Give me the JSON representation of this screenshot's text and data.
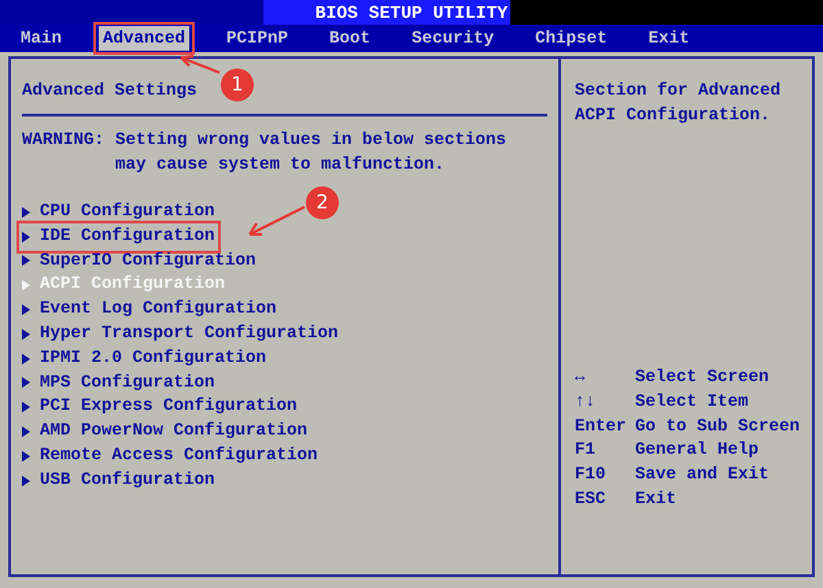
{
  "window": {
    "title": "BIOS SETUP UTILITY"
  },
  "tabs": [
    {
      "label": "Main",
      "selected": false
    },
    {
      "label": "Advanced",
      "selected": true,
      "callout": {
        "number": "1"
      }
    },
    {
      "label": "PCIPnP",
      "selected": false
    },
    {
      "label": "Boot",
      "selected": false
    },
    {
      "label": "Security",
      "selected": false
    },
    {
      "label": "Chipset",
      "selected": false
    },
    {
      "label": "Exit",
      "selected": false
    }
  ],
  "main_panel": {
    "heading": "Advanced Settings",
    "warning_label": "WARNING:",
    "warning_lines": [
      "Setting wrong values in below sections",
      "may cause system to malfunction."
    ],
    "items": [
      {
        "label": "CPU Configuration",
        "selected": false
      },
      {
        "label": "IDE Configuration",
        "selected": false,
        "callout": {
          "number": "2"
        }
      },
      {
        "label": "SuperIO Configuration",
        "selected": false
      },
      {
        "label": "ACPI Configuration",
        "selected": true
      },
      {
        "label": "Event Log Configuration",
        "selected": false
      },
      {
        "label": "Hyper Transport Configuration",
        "selected": false
      },
      {
        "label": "IPMI 2.0 Configuration",
        "selected": false
      },
      {
        "label": "MPS Configuration",
        "selected": false
      },
      {
        "label": "PCI Express Configuration",
        "selected": false
      },
      {
        "label": "AMD PowerNow Configuration",
        "selected": false
      },
      {
        "label": "Remote Access Configuration",
        "selected": false
      },
      {
        "label": "USB Configuration",
        "selected": false
      }
    ]
  },
  "help_panel": {
    "lines": [
      "Section for Advanced",
      "ACPI Configuration."
    ],
    "keys": [
      {
        "key": "↔",
        "action": "Select Screen"
      },
      {
        "key": "↑↓",
        "action": "Select Item"
      },
      {
        "key": "Enter",
        "action": "Go to Sub Screen"
      },
      {
        "key": "F1",
        "action": "General Help"
      },
      {
        "key": "F10",
        "action": "Save and Exit"
      },
      {
        "key": "ESC",
        "action": "Exit"
      }
    ]
  }
}
